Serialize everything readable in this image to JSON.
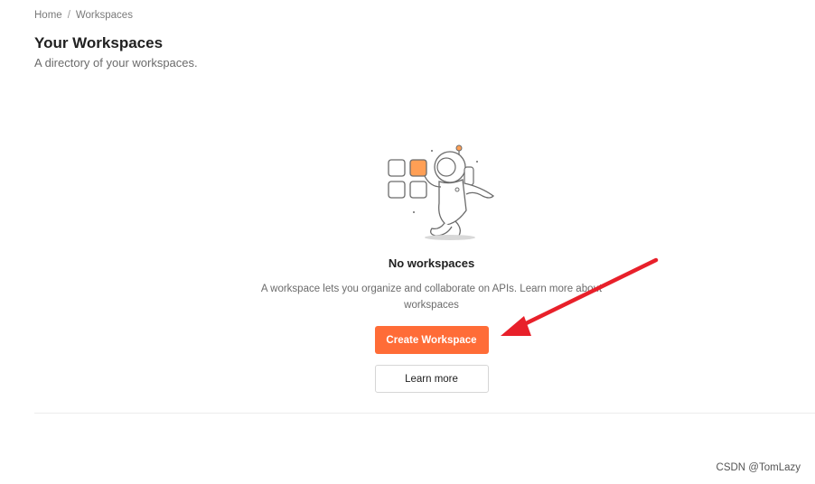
{
  "breadcrumb": {
    "home": "Home",
    "separator": "/",
    "current": "Workspaces"
  },
  "header": {
    "title": "Your Workspaces",
    "subtitle": "A directory of your workspaces."
  },
  "empty_state": {
    "illustration": "astronaut-grid-illustration",
    "title": "No workspaces",
    "description": "A workspace lets you organize and collaborate on APIs. Learn more about workspaces",
    "primary_button": "Create Workspace",
    "secondary_button": "Learn more"
  },
  "annotation": {
    "arrow_icon": "red-arrow-icon",
    "color": "#e8202a"
  },
  "watermark": "CSDN @TomLazy",
  "colors": {
    "accent": "#ff6c37"
  }
}
